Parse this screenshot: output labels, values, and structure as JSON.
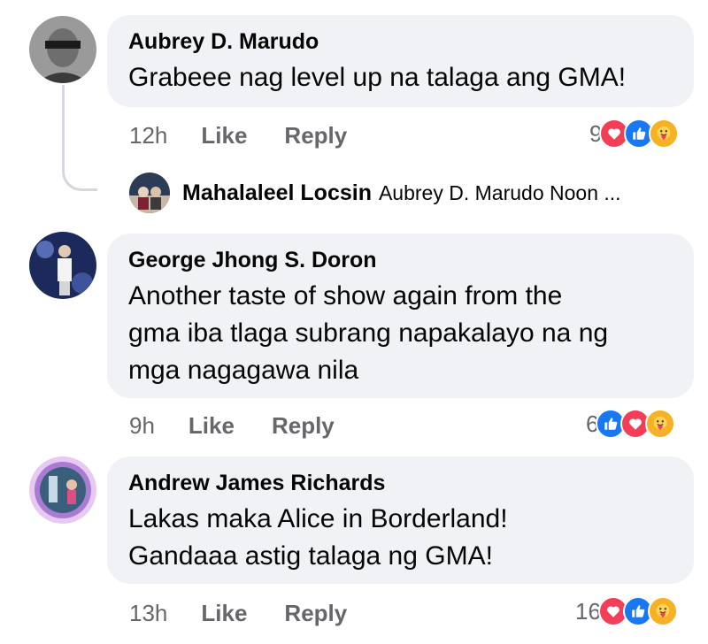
{
  "comments": [
    {
      "author": "Aubrey D. Marudo",
      "text_lines": [
        "Grabeee nag level up na talaga ang GMA!"
      ],
      "time": "12h",
      "like_label": "Like",
      "reply_label": "Reply",
      "reaction_count": "9",
      "reactions": [
        "love",
        "like",
        "care"
      ]
    },
    {
      "author": "George Jhong S. Doron",
      "text_lines": [
        "Another taste of show again from the",
        "gma iba tlaga subrang napakalayo na ng",
        "mga nagagawa nila"
      ],
      "time": "9h",
      "like_label": "Like",
      "reply_label": "Reply",
      "reaction_count": "6",
      "reactions": [
        "like",
        "love",
        "care"
      ]
    },
    {
      "author": "Andrew James Richards",
      "text_lines": [
        "Lakas maka Alice in Borderland!",
        "Gandaaa astig talaga ng GMA!"
      ],
      "time": "13h",
      "like_label": "Like",
      "reply_label": "Reply",
      "reaction_count": "16",
      "reactions": [
        "love",
        "like",
        "care"
      ]
    }
  ],
  "reply_preview": {
    "author": "Mahalaleel Locsin",
    "text": "Aubrey D. Marudo Noon ..."
  },
  "colors": {
    "bubble": "#f0f2f5",
    "secondary_text": "#65676b",
    "like_blue": "#1877f2",
    "love_red": "#f33e58",
    "care_yellow": "#f7b125"
  },
  "icons": {
    "like": "thumbs-up-icon",
    "love": "heart-icon",
    "care": "care-hug-icon"
  }
}
